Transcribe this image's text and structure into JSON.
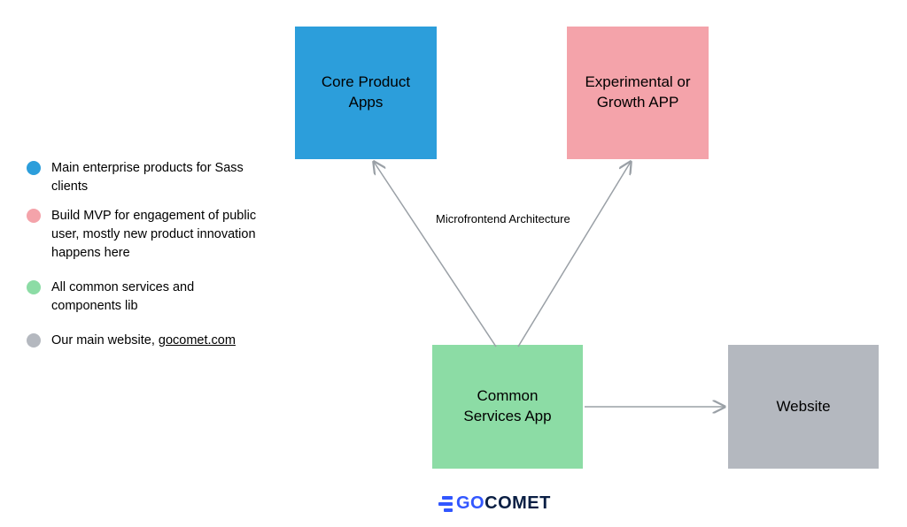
{
  "nodes": {
    "core": {
      "label": "Core Product\nApps",
      "color": "#2c9edb"
    },
    "exp": {
      "label": "Experimental or\nGrowth APP",
      "color": "#f4a3aa"
    },
    "common": {
      "label": "Common\nServices App",
      "color": "#8cdca5"
    },
    "website": {
      "label": "Website",
      "color": "#b4b8bf"
    }
  },
  "edges": {
    "label": "Microfrontend Architecture",
    "connections": [
      {
        "from": "common",
        "to": "core"
      },
      {
        "from": "common",
        "to": "exp"
      },
      {
        "from": "common",
        "to": "website"
      }
    ]
  },
  "legend": {
    "items": [
      {
        "color": "blue",
        "text": "Main enterprise products for Sass clients"
      },
      {
        "color": "pink",
        "text": "Build MVP for engagement of public user, mostly new product innovation happens here"
      },
      {
        "color": "green",
        "text": "All common services and components lib"
      },
      {
        "color": "grey",
        "text_prefix": "Our main website, ",
        "link_text": "gocomet.com"
      }
    ]
  },
  "logo": {
    "part1": "GO",
    "part2": "COMET"
  }
}
